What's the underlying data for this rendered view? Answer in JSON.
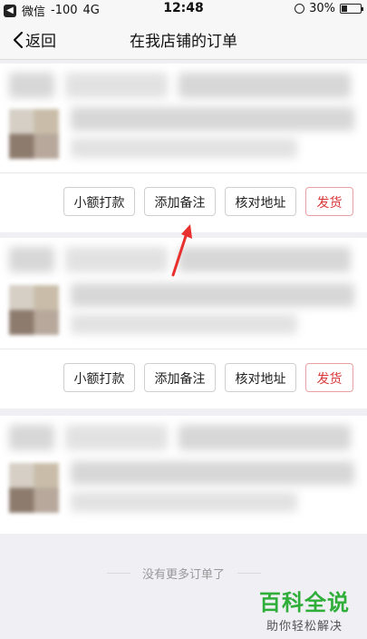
{
  "status_bar": {
    "carrier": "微信",
    "signal": "-100",
    "network": "4G",
    "time": "12:48",
    "battery": "30%",
    "battery_level": 0.3
  },
  "nav": {
    "back_label": "返回",
    "title": "在我店铺的订单"
  },
  "orders": [
    {
      "actions": [
        "小额打款",
        "添加备注",
        "核对地址",
        "发货"
      ]
    },
    {
      "actions": [
        "小额打款",
        "添加备注",
        "核对地址",
        "发货"
      ]
    },
    {
      "actions": []
    }
  ],
  "footer": {
    "end_text": "没有更多订单了"
  },
  "watermark": {
    "title": "百科全说",
    "subtitle": "助你轻松解决"
  },
  "colors": {
    "ship_button": "#d9383a",
    "annotation_arrow": "#e8302e",
    "watermark_green": "#2fae3a"
  },
  "icons": [
    "back-arrow-icon",
    "chevron-left-icon",
    "alarm-icon",
    "battery-icon"
  ]
}
